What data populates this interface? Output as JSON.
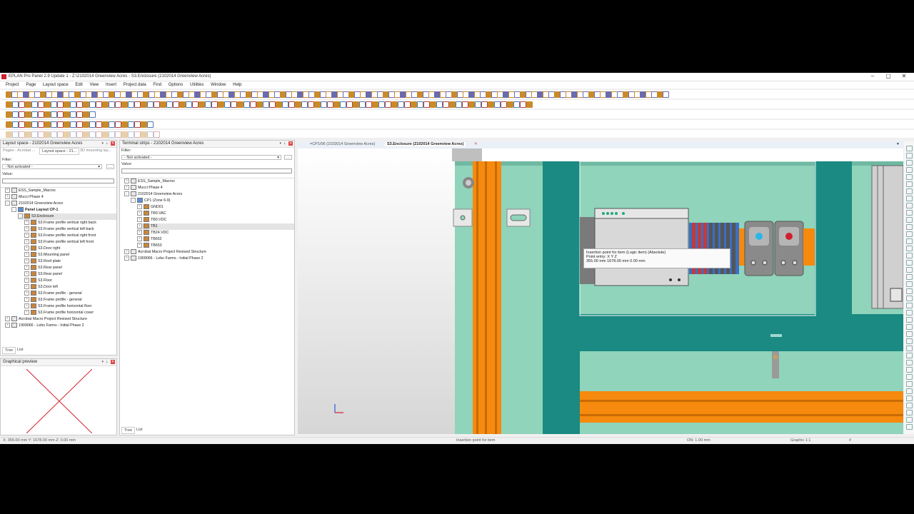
{
  "window": {
    "title": "EPLAN Pro Panel 2.9 Update 1 - Z:\\2102014 Greenview Acres - S3.Enclosure (2102014 Greenview Acres)",
    "controls": [
      "–",
      "▢",
      "✕"
    ]
  },
  "menu": [
    "Project",
    "Page",
    "Layout space",
    "Edit",
    "View",
    "Insert",
    "Project data",
    "Find",
    "Options",
    "Utilities",
    "Window",
    "Help"
  ],
  "layout_panel": {
    "title": "Layout space - 2102014 Greenview Acres",
    "tabs": [
      "Pages - Acrobat ...",
      "Layout space - 21...",
      "3D mounting lay..."
    ],
    "filter_label": "Filter:",
    "filter_value": "- Not activated -",
    "value_label": "Value:",
    "tree": [
      {
        "label": "ESS_Sample_Macros",
        "level": 0,
        "exp": "+"
      },
      {
        "label": "Mucci Phase 4",
        "level": 0,
        "exp": "+"
      },
      {
        "label": "2102014 Greenview Acres",
        "level": 0,
        "exp": "-"
      },
      {
        "label": "Panel Layout CP-1",
        "level": 1,
        "exp": "-",
        "bold": true
      },
      {
        "label": "S3.Enclosure",
        "level": 2,
        "exp": "-",
        "selected": true
      },
      {
        "label": "S3.Frame profile vertical right back",
        "level": 3,
        "exp": "+"
      },
      {
        "label": "S3.Frame profile vertical left back",
        "level": 3,
        "exp": "+"
      },
      {
        "label": "S3.Frame profile vertical right front",
        "level": 3,
        "exp": "+"
      },
      {
        "label": "S3.Frame profile vertical left front",
        "level": 3,
        "exp": "+"
      },
      {
        "label": "S3.Door right",
        "level": 3,
        "exp": "+"
      },
      {
        "label": "S3.Mounting panel",
        "level": 3,
        "exp": "+"
      },
      {
        "label": "S3.Roof plate",
        "level": 3,
        "exp": "+"
      },
      {
        "label": "S3.Rear panel",
        "level": 3,
        "exp": "+"
      },
      {
        "label": "S3.Rear panel",
        "level": 3,
        "exp": "+"
      },
      {
        "label": "S3.Floor",
        "level": 3,
        "exp": "+"
      },
      {
        "label": "S3.Door left",
        "level": 3,
        "exp": "+"
      },
      {
        "label": "S3.Frame profile - general",
        "level": 3,
        "exp": "+"
      },
      {
        "label": "S3.Frame profile - general",
        "level": 3,
        "exp": "+"
      },
      {
        "label": "S3.Frame profile horizontal floor",
        "level": 3,
        "exp": "+"
      },
      {
        "label": "S3.Frame profile horizontal cover",
        "level": 3,
        "exp": "+"
      },
      {
        "label": "Acrobat Macro Project Revised Structure",
        "level": 0,
        "exp": "+"
      },
      {
        "label": "1909066 - Lebo Farms - Initial Phase 2",
        "level": 0,
        "exp": "+"
      }
    ],
    "bottom_tabs": [
      "Tree",
      "List"
    ]
  },
  "preview_panel": {
    "title": "Graphical preview"
  },
  "terminal_panel": {
    "title": "Terminal strips - 2102014 Greenview Acres",
    "filter_label": "Filter:",
    "filter_value": "- Not activated -",
    "value_label": "Value:",
    "tree": [
      {
        "label": "ESS_Sample_Macros",
        "level": 0,
        "exp": "+"
      },
      {
        "label": "Mucci Phase 4",
        "level": 0,
        "exp": "+"
      },
      {
        "label": "2102014 Greenview Acres",
        "level": 0,
        "exp": "-"
      },
      {
        "label": "CP1 (Zone 6-9)",
        "level": 1,
        "exp": "-"
      },
      {
        "label": "GND01",
        "level": 2,
        "exp": "+"
      },
      {
        "label": "TB0.VAC",
        "level": 2,
        "exp": "+"
      },
      {
        "label": "TB0.VDC",
        "level": 2,
        "exp": "+"
      },
      {
        "label": "TB1",
        "level": 2,
        "exp": "+",
        "selected": true
      },
      {
        "label": "TB24.VDC",
        "level": 2,
        "exp": "+"
      },
      {
        "label": "TB652",
        "level": 2,
        "exp": "+"
      },
      {
        "label": "TB653",
        "level": 2,
        "exp": "+"
      },
      {
        "label": "Acrobat Macro Project Revised Structure",
        "level": 0,
        "exp": "+"
      },
      {
        "label": "1909066 - Lebo Farms - Initial Phase 2",
        "level": 0,
        "exp": "+"
      }
    ],
    "bottom_tabs": [
      "Tree",
      "List"
    ]
  },
  "doc_tabs": [
    "=CP1/06 (2102014 Greenview Acres)",
    "S3.Enclosure (2102014 Greenview Acres)"
  ],
  "tooltip": {
    "line1": "Insertion point for item (Logic item) (Absolute)",
    "line2": "Point entry: X Y Z",
    "line3": "355.00 mm 1678.00 mm 0.00 mm"
  },
  "status": {
    "coords": "X: 355.00 mm     Y: 1678.00 mm     Z: 0.00 mm",
    "hint": "Insertion point for item",
    "grid": "ON: 1.00 mm",
    "scale": "Graphic 1:1",
    "hash": "#"
  },
  "colors": {
    "teal": "#1a8a82",
    "mint": "#8fd4bb",
    "orange": "#f58a0e",
    "device_gray": "#d8d8d8",
    "accent_red": "#d0202e"
  }
}
